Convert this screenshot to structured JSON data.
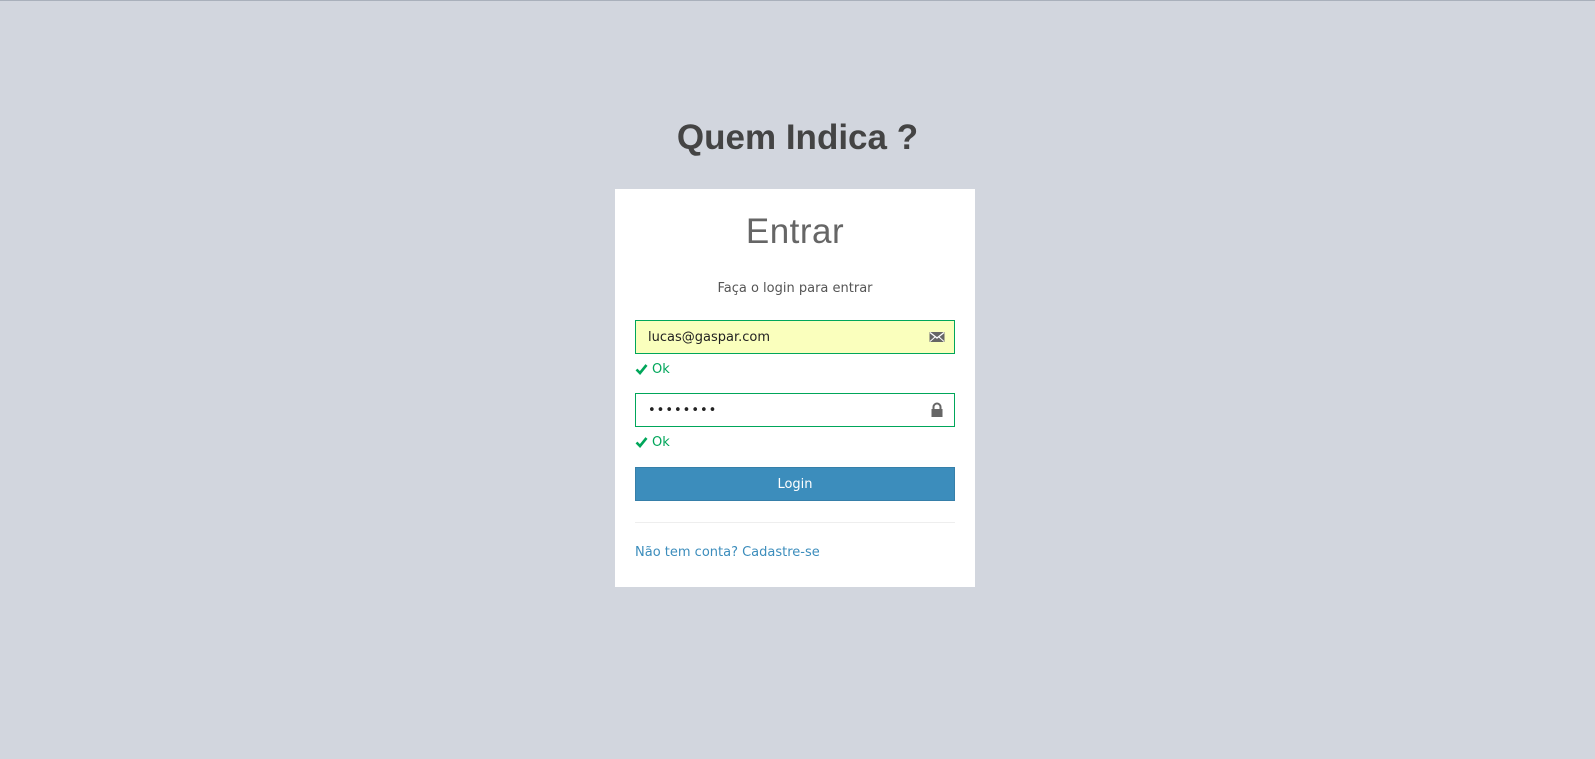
{
  "logo": {
    "text": "Quem Indica ?"
  },
  "login_box": {
    "title": "Entrar",
    "message": "Faça o login para entrar",
    "email": {
      "value": "lucas@gaspar.com",
      "icon": "envelope-icon",
      "status": "Ok"
    },
    "password": {
      "value": "••••••••",
      "icon": "lock-icon",
      "status": "Ok"
    },
    "login_button": "Login",
    "register_link": "Não tem conta? Cadastre-se"
  },
  "colors": {
    "background": "#d2d6de",
    "primary": "#3c8dbc",
    "success": "#00a65a",
    "autofill": "#faffbd"
  }
}
